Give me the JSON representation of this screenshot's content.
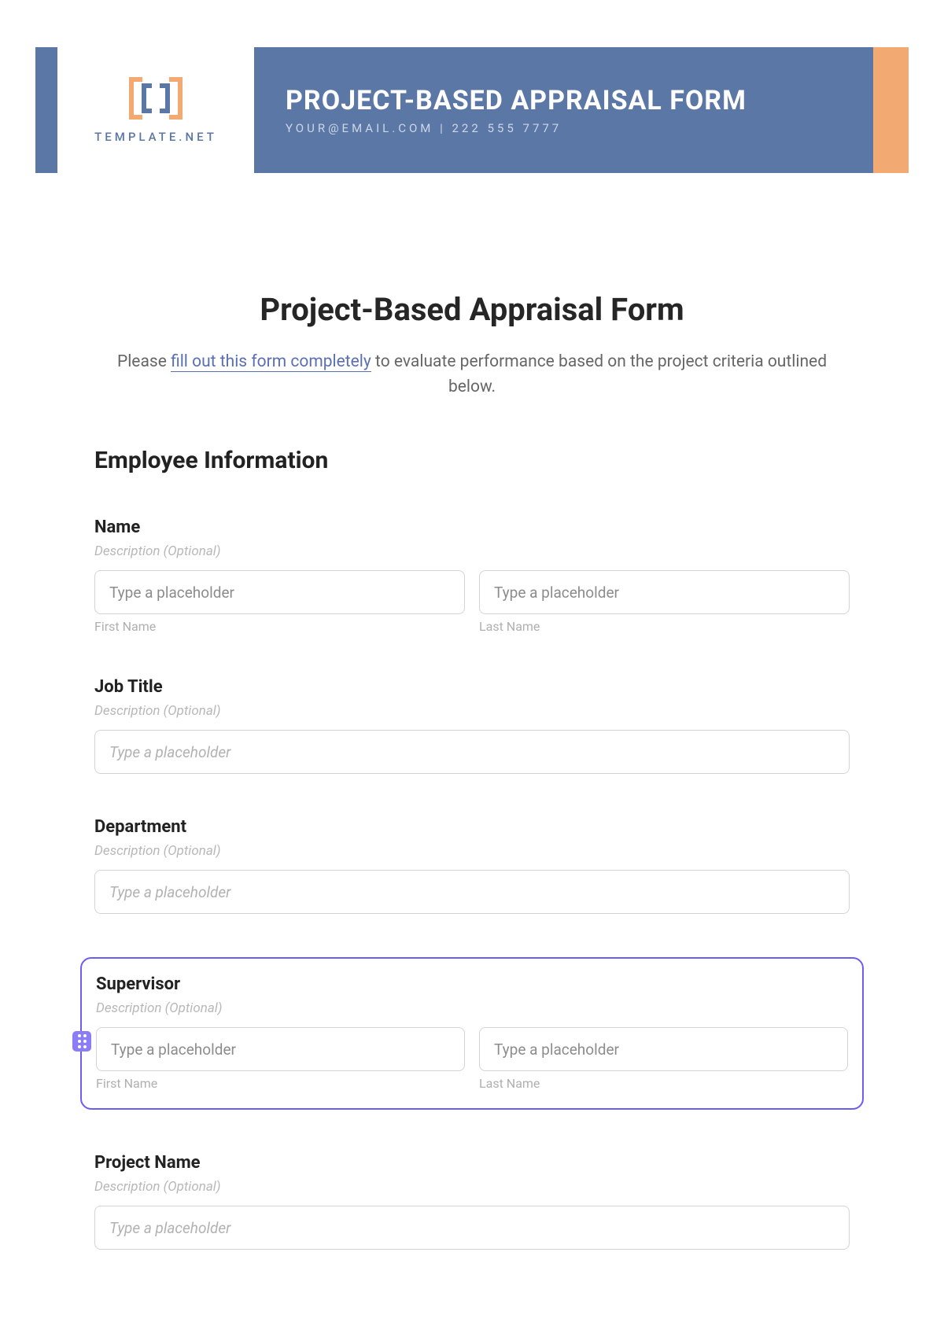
{
  "banner": {
    "logo_text": "TEMPLATE.NET",
    "title": "PROJECT-BASED APPRAISAL FORM",
    "subline": "YOUR@EMAIL.COM | 222 555 7777"
  },
  "page": {
    "title": "Project-Based Appraisal Form",
    "intro_prefix": "Please ",
    "intro_link": "fill out this form completely",
    "intro_suffix": " to evaluate performance based on the project criteria outlined below."
  },
  "section": {
    "employee_info": "Employee Information"
  },
  "fields": {
    "name": {
      "label": "Name",
      "desc": "Description (Optional)",
      "first_ph": "Type a placeholder",
      "last_ph": "Type a placeholder",
      "first_sub": "First Name",
      "last_sub": "Last Name"
    },
    "job_title": {
      "label": "Job Title",
      "desc": "Description (Optional)",
      "ph": "Type a placeholder"
    },
    "department": {
      "label": "Department",
      "desc": "Description (Optional)",
      "ph": "Type a placeholder"
    },
    "supervisor": {
      "label": "Supervisor",
      "desc": "Description (Optional)",
      "first_ph": "Type a placeholder",
      "last_ph": "Type a placeholder",
      "first_sub": "First Name",
      "last_sub": "Last Name"
    },
    "project_name": {
      "label": "Project Name",
      "desc": "Description (Optional)",
      "ph": "Type a placeholder"
    }
  }
}
